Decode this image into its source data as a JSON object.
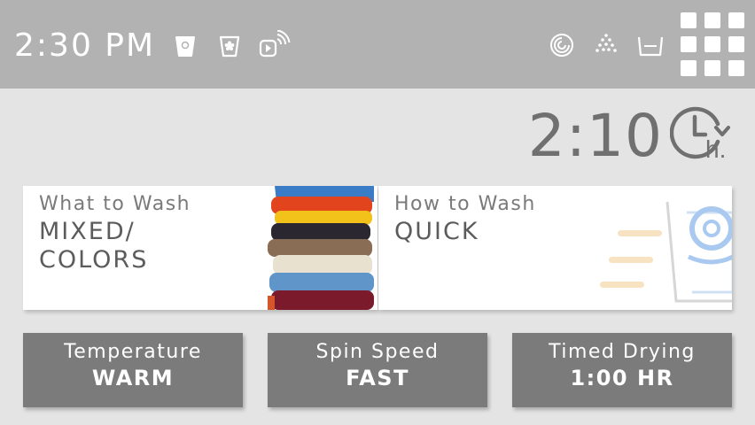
{
  "header": {
    "time": "2:30 PM",
    "status_icons": [
      "detergent-cup-icon",
      "softener-cup-icon",
      "remote-start-icon"
    ],
    "cycle_icons": [
      "wash-swirl-icon",
      "rinse-spray-icon",
      "basin-icon"
    ],
    "menu_icon": "menu-grid-icon"
  },
  "cycle": {
    "time_remaining": "2:10",
    "delay_icon": "delay-hours-icon"
  },
  "cards": {
    "what_to_wash": {
      "label": "What to Wash",
      "value": "MIXED/\nCOLORS"
    },
    "how_to_wash": {
      "label": "How to Wash",
      "value": "QUICK"
    }
  },
  "buttons": {
    "temperature": {
      "label": "Temperature",
      "value": "WARM"
    },
    "spin_speed": {
      "label": "Spin Speed",
      "value": "FAST"
    },
    "timed_drying": {
      "label": "Timed Drying",
      "value": "1:00 HR"
    }
  },
  "colors": {
    "header_bg": "#b2b2b2",
    "page_bg": "#e4e4e4",
    "button_bg": "#7b7b7b",
    "accent_blue": "#a9c9f0",
    "accent_orange": "#f7e2c2"
  }
}
